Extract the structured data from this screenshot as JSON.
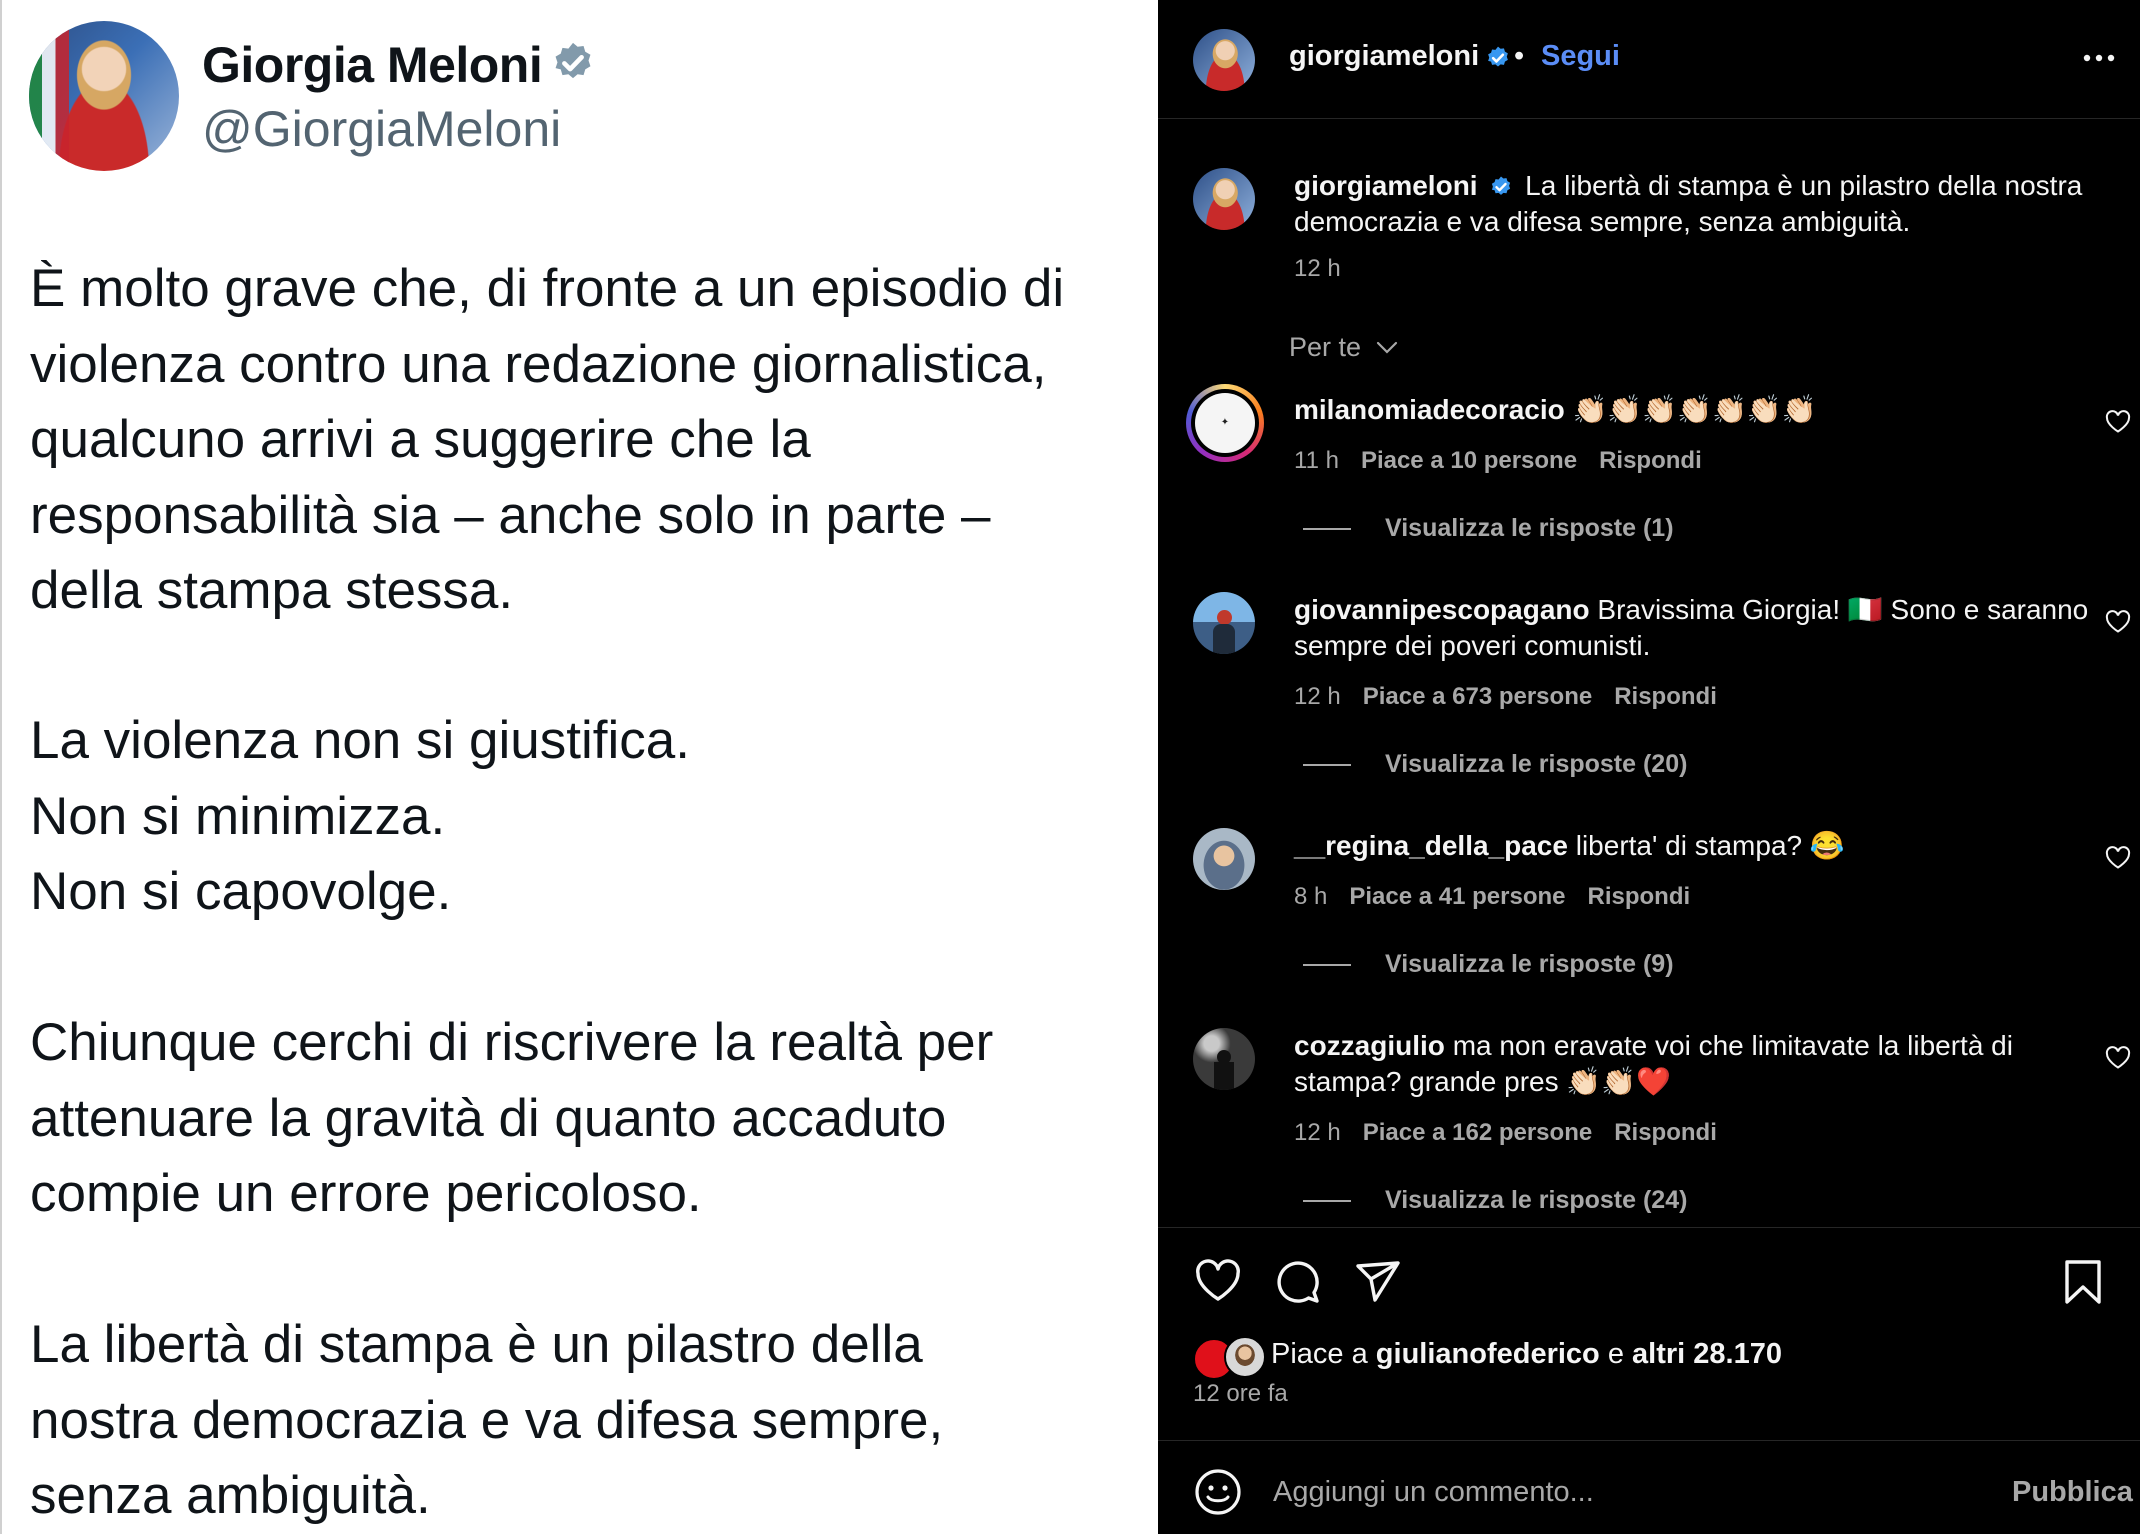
{
  "tweet": {
    "name": "Giorgia Meloni",
    "handle": "@GiorgiaMeloni",
    "paragraphs": [
      [
        "È molto grave che, di fronte a un episodio di",
        "violenza contro una redazione giornalistica,",
        "qualcuno arrivi a suggerire che la",
        "responsabilità sia – anche solo in parte –",
        "della stampa stessa."
      ],
      [
        "La violenza non si giustifica.",
        "Non si minimizza.",
        "Non si capovolge."
      ],
      [
        "Chiunque cerchi di riscrivere la realtà per",
        "attenuare la gravità di quanto accaduto",
        "compie un errore pericoloso."
      ],
      [
        "La libertà di stampa è un pilastro della",
        "nostra democrazia e va difesa sempre,",
        "senza ambiguità."
      ]
    ]
  },
  "instagram": {
    "header": {
      "username": "giorgiameloni",
      "separator": "•",
      "follow_label": "Segui"
    },
    "caption": {
      "username": "giorgiameloni",
      "text": "La libertà di stampa è un pilastro della nostra democrazia e va difesa sempre, senza ambiguità.",
      "time": "12 h"
    },
    "filter_label": "Per te",
    "comments": [
      {
        "username": "milanomiadecoracio",
        "text": "👏🏻👏🏻👏🏻👏🏻👏🏻👏🏻👏🏻",
        "time": "11 h",
        "likes": "Piace a 10 persone",
        "reply": "Rispondi",
        "view_replies": "Visualizza le risposte (1)"
      },
      {
        "username": "giovannipescopagano",
        "text": "Bravissima Giorgia! 🇮🇹 Sono e saranno sempre dei poveri comunisti.",
        "time": "12 h",
        "likes": "Piace a 673 persone",
        "reply": "Rispondi",
        "view_replies": "Visualizza le risposte (20)"
      },
      {
        "username": "__regina_della_pace",
        "text": "liberta' di stampa? 😂",
        "time": "8 h",
        "likes": "Piace a 41 persone",
        "reply": "Rispondi",
        "view_replies": "Visualizza le risposte (9)"
      },
      {
        "username": "cozzagiulio",
        "text": "ma non eravate voi che limitavate la libertà di stampa? grande pres 👏🏻👏🏻❤️",
        "time": "12 h",
        "likes": "Piace a 162 persone",
        "reply": "Rispondi",
        "view_replies": "Visualizza le risposte (24)"
      }
    ],
    "likes": {
      "prefix": "Piace a",
      "user": "giulianofederico",
      "middle": "e",
      "others": "altri 28.170"
    },
    "time_ago": "12 ore fa",
    "comment_placeholder": "Aggiungi un commento...",
    "publish_label": "Pubblica",
    "icons": [
      "more-icon",
      "heart-icon",
      "comment-icon",
      "share-icon",
      "bookmark-icon",
      "emoji-icon",
      "verified-badge-icon",
      "chevron-down-icon"
    ],
    "colors": {
      "follow": "#5b8df6",
      "verified": "#3897f0",
      "muted": "#a8a8a8",
      "background": "#000000"
    }
  }
}
